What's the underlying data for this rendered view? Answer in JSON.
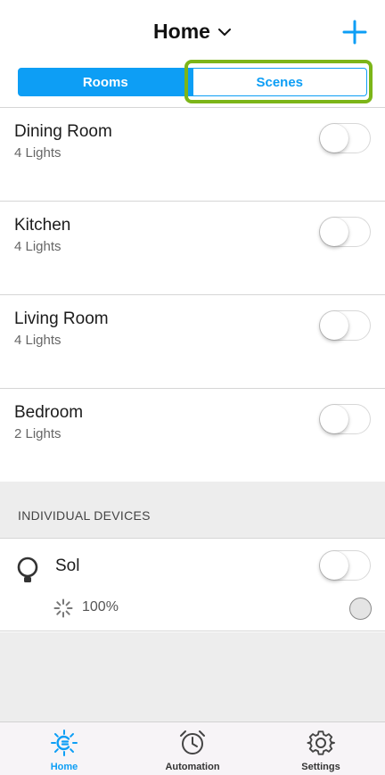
{
  "header": {
    "title": "Home",
    "title_icon": "chevron-down-icon",
    "add_icon": "plus-icon"
  },
  "segments": {
    "rooms_label": "Rooms",
    "scenes_label": "Scenes",
    "selected": "Rooms"
  },
  "rooms": [
    {
      "name": "Dining Room",
      "count": "4 Lights",
      "on": false
    },
    {
      "name": "Kitchen",
      "count": "4 Lights",
      "on": false
    },
    {
      "name": "Living Room",
      "count": "4 Lights",
      "on": false
    },
    {
      "name": "Bedroom",
      "count": "2 Lights",
      "on": false
    }
  ],
  "devices_section": {
    "label": "INDIVIDUAL DEVICES"
  },
  "devices": [
    {
      "name": "Sol",
      "brightness": "100%",
      "on": false,
      "icon": "bulb-icon"
    }
  ],
  "tabs": [
    {
      "label": "Home",
      "icon": "home-icon",
      "active": true
    },
    {
      "label": "Automation",
      "icon": "alarm-clock-icon",
      "active": false
    },
    {
      "label": "Settings",
      "icon": "gear-icon",
      "active": false
    }
  ],
  "colors": {
    "accent": "#0d9ef5",
    "highlight": "#7cb518",
    "section_bg": "#ededed",
    "tabbar_bg": "#f7f4f7"
  }
}
